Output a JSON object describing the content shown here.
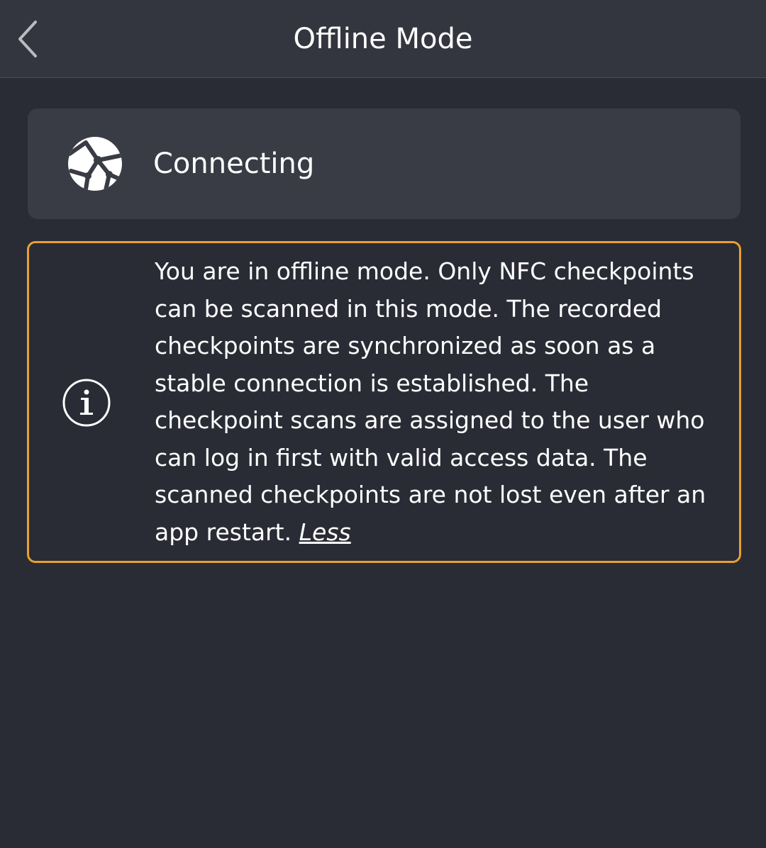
{
  "header": {
    "title": "Offline Mode",
    "back_icon": "chevron-left-icon"
  },
  "status": {
    "icon": "globe-network-icon",
    "label": "Connecting"
  },
  "info": {
    "icon": "info-circle-icon",
    "accent_color": "#e8a030",
    "message": "You are in offline mode. Only NFC checkpoints can be scanned in this mode. The recorded checkpoints are synchronized as soon as a stable connection is established. The checkpoint scans are assigned to the user who can log in first with valid access data. The scanned checkpoints are not lost even after an app restart.",
    "toggle_label": "Less"
  }
}
